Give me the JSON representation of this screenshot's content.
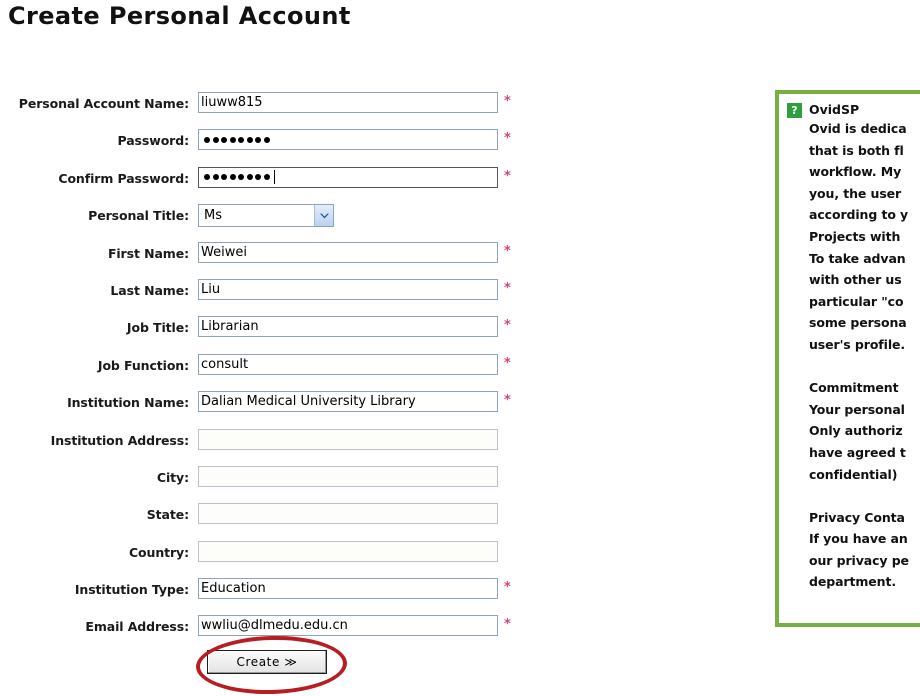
{
  "page": {
    "title": "Create Personal Account"
  },
  "form": {
    "rows": [
      {
        "label": "Personal Account Name:",
        "value": "liuww815",
        "type": "text",
        "required": true,
        "state": "filled"
      },
      {
        "label": "Password:",
        "value": "",
        "type": "password",
        "dots": 8,
        "required": true,
        "state": "filled",
        "masked_display": "●●●●●●●●"
      },
      {
        "label": "Confirm Password:",
        "value": "",
        "type": "password",
        "dots": 8,
        "required": true,
        "state": "focused",
        "masked_display": "●●●●●●●●"
      },
      {
        "label": "Personal Title:",
        "value": "Ms",
        "type": "select",
        "required": false,
        "state": "filled"
      },
      {
        "label": "First Name:",
        "value": "Weiwei",
        "type": "text",
        "required": true,
        "state": "filled"
      },
      {
        "label": "Last Name:",
        "value": "Liu",
        "type": "text",
        "required": true,
        "state": "filled"
      },
      {
        "label": "Job Title:",
        "value": "Librarian",
        "type": "text",
        "required": true,
        "state": "filled"
      },
      {
        "label": "Job Function:",
        "value": "consult",
        "type": "text",
        "required": true,
        "state": "filled"
      },
      {
        "label": "Institution Name:",
        "value": "Dalian Medical University Library",
        "type": "text",
        "required": true,
        "state": "filled"
      },
      {
        "label": "Institution Address:",
        "value": "",
        "type": "text",
        "required": false,
        "state": "empty"
      },
      {
        "label": "City:",
        "value": "",
        "type": "text",
        "required": false,
        "state": "empty"
      },
      {
        "label": "State:",
        "value": "",
        "type": "text",
        "required": false,
        "state": "empty"
      },
      {
        "label": "Country:",
        "value": "",
        "type": "text",
        "required": false,
        "state": "empty"
      },
      {
        "label": "Institution Type:",
        "value": "Education",
        "type": "text",
        "required": true,
        "state": "filled"
      },
      {
        "label": "Email Address:",
        "value": "wwliu@dlmedu.edu.cn",
        "type": "text",
        "required": true,
        "state": "filled"
      }
    ],
    "required_marker": "*",
    "submit_label": "Create ≫"
  },
  "help_panel": {
    "icon": "question-mark-icon",
    "title": "OvidSP",
    "paragraphs": [
      "Ovid is dedica\nthat is both fl\nworkflow. My\nyou, the user\naccording to y\nProjects with\nTo take advan\nwith other us\nparticular \"co\nsome persona\nuser's profile.",
      "Commitment \nYour personal\nOnly authoriz\nhave agreed t\nconfidential) ",
      "Privacy Conta\nIf you have an\nour privacy pe\ndepartment."
    ]
  },
  "colors": {
    "panel_border_green": "#76b043",
    "help_icon_green": "#2f9e3f",
    "required_star": "#d2457f",
    "annotation_red": "#b81d22",
    "input_border": "#8ea3b8",
    "empty_input_border": "#b9c2cc"
  }
}
